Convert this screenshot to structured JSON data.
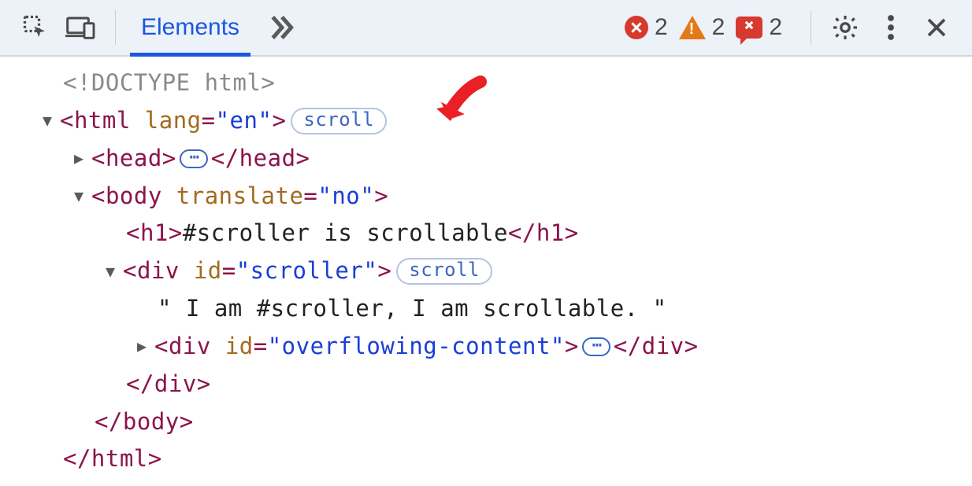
{
  "toolbar": {
    "tab_elements": "Elements",
    "errors_count": "2",
    "warnings_count": "2",
    "issues_count": "2"
  },
  "badges": {
    "scroll": "scroll"
  },
  "dom": {
    "doctype": "<!DOCTYPE html>",
    "html_open_pre": "<",
    "html_tag": "html",
    "html_attr_name": "lang",
    "html_attr_val": "\"en\"",
    "html_open_post": ">",
    "head_open": "<head>",
    "head_close": "</head>",
    "body_open_pre": "<",
    "body_tag": "body",
    "body_attr_name": "translate",
    "body_attr_val": "\"no\"",
    "body_open_post": ">",
    "h1_open": "<h1>",
    "h1_text": "#scroller is scrollable",
    "h1_close": "</h1>",
    "div1_open_pre": "<",
    "div_tag": "div",
    "div1_attr_name": "id",
    "div1_attr_val": "\"scroller\"",
    "div1_open_post": ">",
    "text_node": "\" I am #scroller, I am scrollable. \"",
    "div2_open_pre": "<",
    "div2_attr_name": "id",
    "div2_attr_val": "\"overflowing-content\"",
    "div2_open_post": ">",
    "div_close": "</div>",
    "body_close": "</body>",
    "html_close": "</html>"
  }
}
